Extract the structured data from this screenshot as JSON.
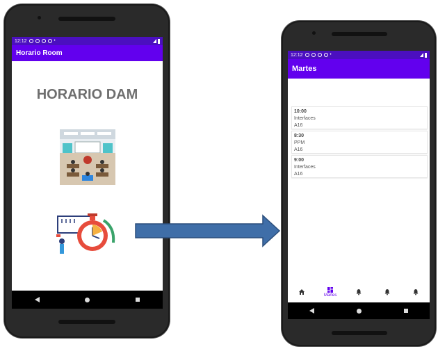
{
  "left_phone": {
    "status": {
      "time": "12:12"
    },
    "app_title": "Horario Room",
    "heading": "HORARIO DAM"
  },
  "right_phone": {
    "status": {
      "time": "12:12"
    },
    "app_title": "Martes",
    "items": [
      {
        "time": "10:00",
        "subject": "Interfaces",
        "room": "A16"
      },
      {
        "time": "8:30",
        "subject": "PPM",
        "room": "A16"
      },
      {
        "time": "9:00",
        "subject": "Interfaces",
        "room": "A16"
      }
    ],
    "bottom_nav": [
      {
        "icon": "home-icon",
        "label": ""
      },
      {
        "icon": "dashboard-icon",
        "label": "Martes"
      },
      {
        "icon": "bell-icon",
        "label": ""
      },
      {
        "icon": "bell-icon",
        "label": ""
      },
      {
        "icon": "bell-icon",
        "label": ""
      }
    ]
  },
  "colors": {
    "primary": "#6200ee",
    "status": "#4b0fbf",
    "arrow": "#3f6ea8"
  }
}
